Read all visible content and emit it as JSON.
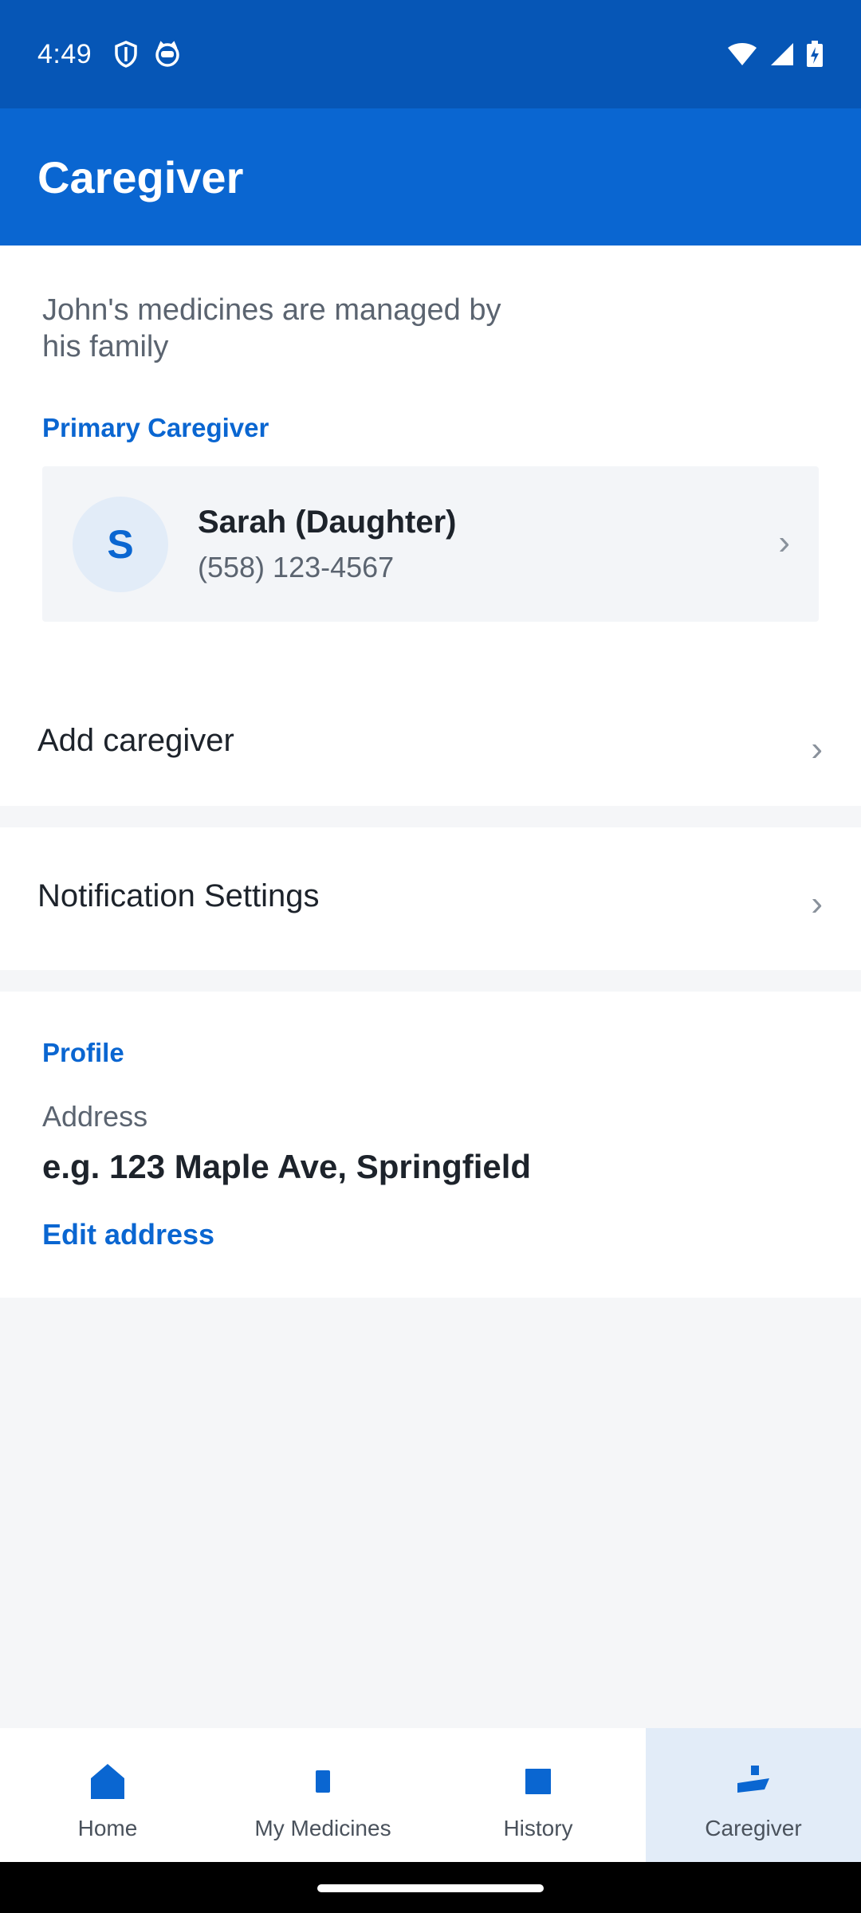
{
  "status_bar": {
    "time": "4:49",
    "icons": [
      "shield-icon",
      "cat-face-icon",
      "wifi-icon",
      "signal-icon",
      "battery-charging-icon"
    ]
  },
  "app_bar": {
    "title": "Caregiver"
  },
  "caregiver_section": {
    "managed_text": "John's medicines are managed by his family",
    "primary_label": "Primary Caregiver",
    "primary": {
      "initial": "S",
      "name": "Sarah (Daughter)",
      "phone": "(558) 123-4567"
    },
    "add_label": "Add caregiver"
  },
  "notifications": {
    "label": "Notification Settings"
  },
  "profile": {
    "label": "Profile",
    "address_label": "Address",
    "address_value": "e.g. 123 Maple Ave, Springfield",
    "edit_label": "Edit address"
  },
  "bottom_nav": {
    "active": "Caregiver",
    "items": [
      {
        "label": "Home",
        "icon": "home-icon"
      },
      {
        "label": "My Medicines",
        "icon": "medicine-icon"
      },
      {
        "label": "History",
        "icon": "history-icon"
      },
      {
        "label": "Caregiver",
        "icon": "caregiver-icon"
      }
    ]
  },
  "colors": {
    "status_bar": "#0656b6",
    "app_bar": "#0a66d1",
    "accent": "#0a66d1",
    "nav_active_bg": "#e2ecf8"
  }
}
